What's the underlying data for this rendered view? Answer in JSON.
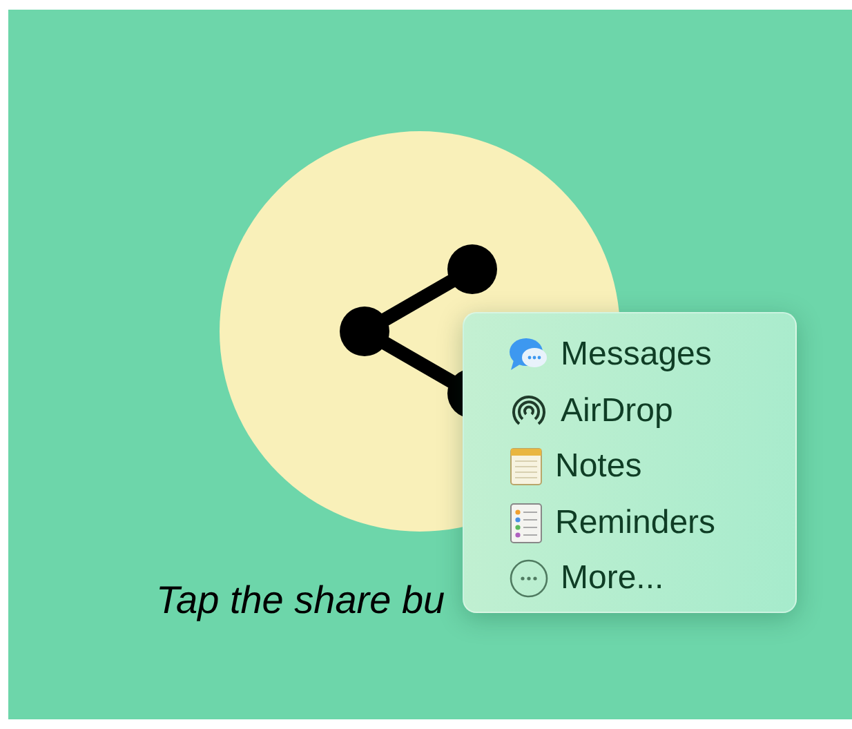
{
  "caption": "Tap the share bu",
  "share_menu": {
    "items": [
      {
        "kind": "messages",
        "label": "Messages"
      },
      {
        "kind": "airdrop",
        "label": "AirDrop"
      },
      {
        "kind": "notes",
        "label": "Notes"
      },
      {
        "kind": "reminders",
        "label": "Reminders"
      },
      {
        "kind": "more",
        "label": "More..."
      }
    ]
  }
}
